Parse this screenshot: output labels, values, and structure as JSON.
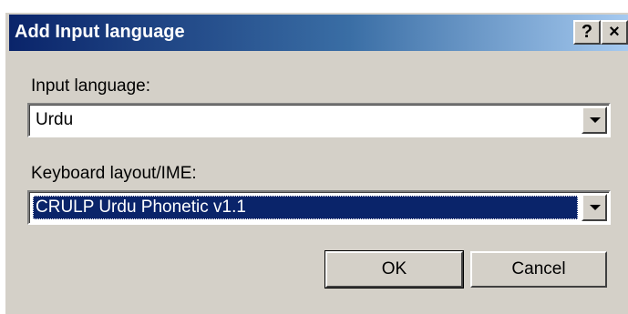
{
  "window": {
    "title": "Add Input language",
    "help_glyph": "?",
    "close_glyph": "×"
  },
  "input_language": {
    "label": "Input language:",
    "selected": "Urdu"
  },
  "keyboard_layout": {
    "label": "Keyboard layout/IME:",
    "selected": "CRULP Urdu Phonetic v1.1"
  },
  "buttons": {
    "ok_label": "OK",
    "cancel_label": "Cancel"
  },
  "icons": {
    "help": "help-icon",
    "close": "close-icon",
    "dropdown": "chevron-down-icon"
  },
  "colors": {
    "titlebar_start": "#0a246a",
    "titlebar_end": "#a6caf0",
    "dialog_face": "#d4d0c8",
    "selection": "#0a246a"
  }
}
